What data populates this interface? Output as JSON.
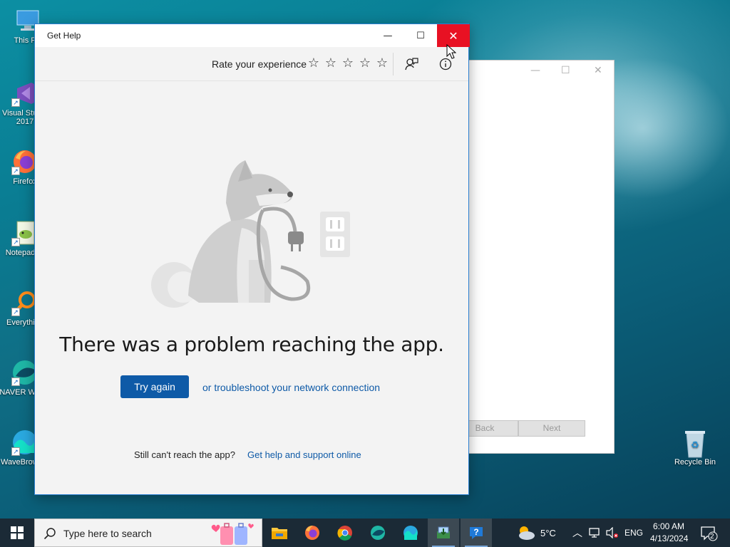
{
  "desktop": {
    "icons": [
      {
        "label": "This PC",
        "icon": "monitor-icon"
      },
      {
        "label": "Visual Studio 2017",
        "icon": "visual-studio-icon"
      },
      {
        "label": "Firefox",
        "icon": "firefox-icon"
      },
      {
        "label": "Notepad++",
        "icon": "notepad-icon"
      },
      {
        "label": "Everything",
        "icon": "search-magnifier-icon"
      },
      {
        "label": "NAVER Whale",
        "icon": "whale-icon"
      },
      {
        "label": "WaveBrowser",
        "icon": "wave-icon"
      }
    ],
    "recycle_bin": {
      "label": "Recycle Bin",
      "icon": "recycle-bin-icon"
    }
  },
  "background_window": {
    "buttons": {
      "back": "Back",
      "next": "Next"
    }
  },
  "window": {
    "title": "Get Help",
    "controls": {
      "minimize": "—",
      "maximize": "☐",
      "close": "✕"
    },
    "toolbar": {
      "rate_label": "Rate your experience",
      "stars": [
        "☆",
        "☆",
        "☆",
        "☆",
        "☆"
      ],
      "feedback_icon": "feedback-icon",
      "info_icon": "info-icon"
    },
    "error": {
      "headline": "There was a problem reaching the app.",
      "try_again": "Try again",
      "troubleshoot": "or troubleshoot your network connection",
      "still_text": "Still can't reach the app?",
      "support_link": "Get help and support online"
    }
  },
  "taskbar": {
    "search_placeholder": "Type here to search",
    "apps": [
      "file-explorer-icon",
      "firefox-icon",
      "chrome-icon",
      "naver-whale-icon",
      "wavebrowser-icon",
      "installer-icon",
      "get-help-icon"
    ],
    "weather": "5°C",
    "language": "ENG",
    "time": "6:00 AM",
    "date": "4/13/2024",
    "notification_count": "2"
  },
  "colors": {
    "accent": "#0e5aa7",
    "close_red": "#e81123",
    "taskbar": "#1b2a36"
  }
}
